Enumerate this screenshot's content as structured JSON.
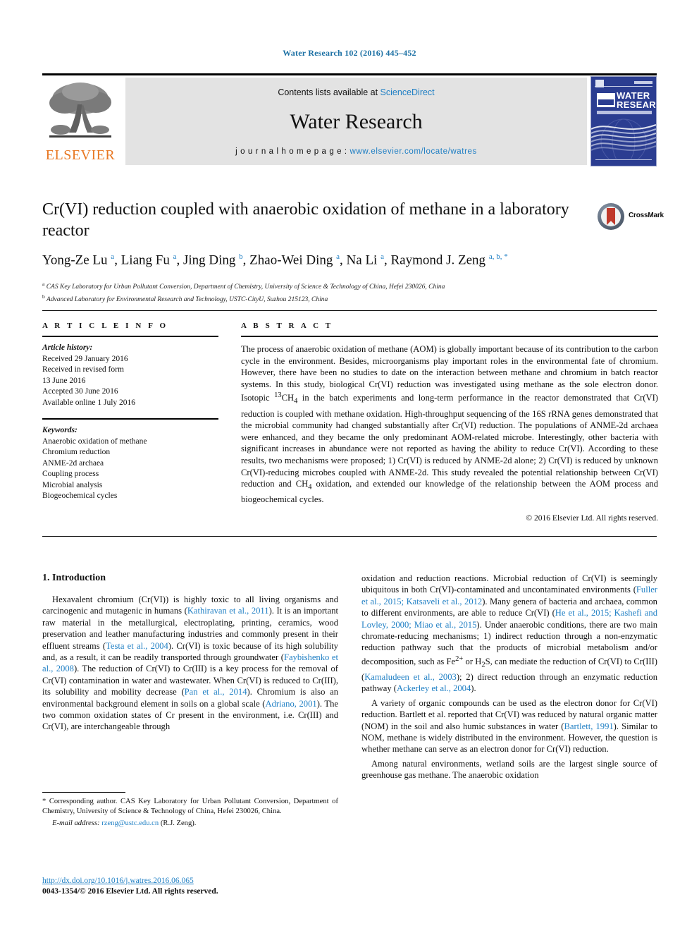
{
  "running_head": "Water Research 102 (2016) 445–452",
  "masthead": {
    "publisher_name": "ELSEVIER",
    "contents_prefix": "Contents lists available at ",
    "contents_link": "ScienceDirect",
    "journal_title": "Water Research",
    "homepage_label": "j o u r n a l   h o m e p a g e :  ",
    "homepage_url": "www.elsevier.com/locate/watres",
    "cover_line1": "WATER",
    "cover_line2": "RESEARCH"
  },
  "article": {
    "title": "Cr(VI) reduction coupled with anaerobic oxidation of methane in a laboratory reactor",
    "crossmark_label": "CrossMark",
    "authors_html": "Yong-Ze Lu <sup>a</sup>, Liang Fu <sup>a</sup>, Jing Ding <sup>b</sup>, Zhao-Wei Ding <sup>a</sup>, Na Li <sup>a</sup>, Raymond J. Zeng <sup>a, b, *</sup>",
    "affiliation_a": "CAS Key Laboratory for Urban Pollutant Conversion, Department of Chemistry, University of Science & Technology of China, Hefei 230026, China",
    "affiliation_b": "Advanced Laboratory for Environmental Research and Technology, USTC-CityU, Suzhou 215123, China"
  },
  "info": {
    "heading": "A R T I C L E   I N F O",
    "history_label": "Article history:",
    "history": [
      "Received 29 January 2016",
      "Received in revised form",
      "13 June 2016",
      "Accepted 30 June 2016",
      "Available online 1 July 2016"
    ],
    "keywords_label": "Keywords:",
    "keywords": [
      "Anaerobic oxidation of methane",
      "Chromium reduction",
      "ANME-2d archaea",
      "Coupling process",
      "Microbial analysis",
      "Biogeochemical cycles"
    ]
  },
  "abstract": {
    "heading": "A B S T R A C T",
    "text_html": "The process of anaerobic oxidation of methane (AOM) is globally important because of its contribution to the carbon cycle in the environment. Besides, microorganisms play important roles in the environmental fate of chromium. However, there have been no studies to date on the interaction between methane and chromium in batch reactor systems. In this study, biological Cr(VI) reduction was investigated using methane as the sole electron donor. Isotopic <sup>13</sup>CH<sub>4</sub> in the batch experiments and long-term performance in the reactor demonstrated that Cr(VI) reduction is coupled with methane oxidation. High-throughput sequencing of the 16S rRNA genes demonstrated that the microbial community had changed substantially after Cr(VI) reduction. The populations of ANME-2d archaea were enhanced, and they became the only predominant AOM-related microbe. Interestingly, other bacteria with significant increases in abundance were not reported as having the ability to reduce Cr(VI). According to these results, two mechanisms were proposed; 1) Cr(VI) is reduced by ANME-2d alone; 2) Cr(VI) is reduced by unknown Cr(VI)-reducing microbes coupled with ANME-2d. This study revealed the potential relationship between Cr(VI) reduction and CH<sub>4</sub> oxidation, and extended our knowledge of the relationship between the AOM process and biogeochemical cycles.",
    "copyright": "© 2016 Elsevier Ltd. All rights reserved."
  },
  "body": {
    "section_heading": "1.  Introduction",
    "left_paragraphs_html": [
      "Hexavalent chromium (Cr(VI)) is highly toxic to all living organisms and carcinogenic and mutagenic in humans (<span class=\"cite\">Kathiravan et al., 2011</span>). It is an important raw material in the metallurgical, electroplating, printing, ceramics, wood preservation and leather manufacturing industries and commonly present in their effluent streams (<span class=\"cite\">Testa et al., 2004</span>). Cr(VI) is toxic because of its high solubility and, as a result, it can be readily transported through groundwater (<span class=\"cite\">Faybishenko et al., 2008</span>). The reduction of Cr(VI) to Cr(III) is a key process for the removal of Cr(VI) contamination in water and wastewater. When Cr(VI) is reduced to Cr(III), its solubility and mobility decrease (<span class=\"cite\">Pan et al., 2014</span>). Chromium is also an environmental background element in soils on a global scale (<span class=\"cite\">Adriano, 2001</span>). The two common oxidation states of Cr present in the environment, i.e. Cr(III) and Cr(VI), are interchangeable through"
    ],
    "right_paragraphs_html": [
      "oxidation and reduction reactions. Microbial reduction of Cr(VI) is seemingly ubiquitous in both Cr(VI)-contaminated and uncontaminated environments (<span class=\"cite\">Fuller et al., 2015; Katsaveli et al., 2012</span>). Many genera of bacteria and archaea, common to different environments, are able to reduce Cr(VI) (<span class=\"cite\">He et al., 2015; Kashefi and Lovley, 2000; Miao et al., 2015</span>). Under anaerobic conditions, there are two main chromate-reducing mechanisms; 1) indirect reduction through a non-enzymatic reduction pathway such that the products of microbial metabolism and/or decomposition, such as Fe<sup>2+</sup> or H<sub>2</sub>S, can mediate the reduction of Cr(VI) to Cr(III) (<span class=\"cite\">Kamaludeen et al., 2003</span>); 2) direct reduction through an enzymatic reduction pathway (<span class=\"cite\">Ackerley et al., 2004</span>).",
      "A variety of organic compounds can be used as the electron donor for Cr(VI) reduction. Bartlett et al. reported that Cr(VI) was reduced by natural organic matter (NOM) in the soil and also humic substances in water (<span class=\"cite\">Bartlett, 1991</span>). Similar to NOM, methane is widely distributed in the environment. However, the question is whether methane can serve as an electron donor for Cr(VI) reduction.",
      "Among natural environments, wetland soils are the largest single source of greenhouse gas methane. The anaerobic oxidation"
    ]
  },
  "footnote": {
    "text_html": "* Corresponding author. CAS Key Laboratory for Urban Pollutant Conversion, Department of Chemistry, University of Science & Technology of China, Hefei 230026, China.",
    "email_label": "E-mail address:",
    "email": "rzeng@ustc.edu.cn",
    "email_suffix": "(R.J. Zeng)."
  },
  "footer": {
    "doi": "http://dx.doi.org/10.1016/j.watres.2016.06.065",
    "issn_line": "0043-1354/© 2016 Elsevier Ltd. All rights reserved."
  },
  "colors": {
    "link_blue": "#1f7fc4",
    "header_blue": "#1a6fa3",
    "elsevier_orange": "#E87722",
    "cover_navy": "#2b3d91",
    "crossmark_red": "#c0392b"
  }
}
